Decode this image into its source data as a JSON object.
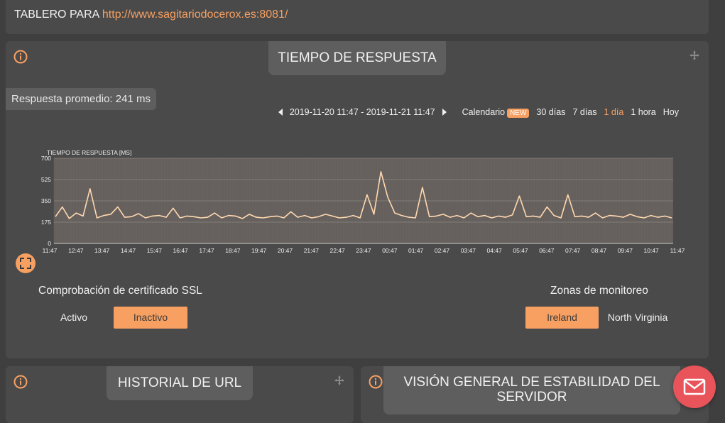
{
  "header": {
    "prefix": "TABLERO PARA",
    "url": "http://www.sagitariodocerox.es:8081/"
  },
  "response_panel": {
    "title": "TIEMPO DE RESPUESTA",
    "average": "Respuesta promedio: 241 ms",
    "date_range": "2019-11-20 11:47 - 2019-11-21 11:47",
    "calendar_label": "Calendario",
    "new_badge": "NEW",
    "ranges": [
      "30 días",
      "7 días",
      "1 día",
      "1 hora",
      "Hoy"
    ],
    "active_range": "1 día",
    "ssl": {
      "title": "Comprobación de certificado SSL",
      "active": "Activo",
      "inactive": "Inactivo",
      "selected": "Inactivo"
    },
    "zones": {
      "title": "Zonas de monitoreo",
      "options": [
        "Ireland",
        "North Virginia"
      ],
      "selected": "Ireland"
    }
  },
  "chart_data": {
    "type": "line",
    "title": "TIEMPO DE RESPUESTA [MS]",
    "xlabel": "",
    "ylabel": "TIEMPO DE RESPUESTA [MS]",
    "ylim": [
      0,
      700
    ],
    "yticks": [
      0,
      175,
      350,
      525,
      700
    ],
    "categories": [
      "11:47",
      "12:47",
      "13:47",
      "14:47",
      "15:47",
      "16:47",
      "17:47",
      "18:47",
      "19:47",
      "20:47",
      "21:47",
      "22:47",
      "23:47",
      "00:47",
      "01:47",
      "02:47",
      "03:47",
      "04:47",
      "05:47",
      "06:47",
      "07:47",
      "08:47",
      "09:47",
      "10:47",
      "11:47"
    ],
    "series": [
      {
        "values": [
          220,
          300,
          205,
          250,
          225,
          450,
          210,
          230,
          240,
          300,
          215,
          220,
          245,
          210,
          225,
          230,
          215,
          290,
          210,
          225,
          220,
          210,
          215,
          250,
          210,
          230,
          225,
          205,
          240,
          215,
          210,
          220,
          225,
          210,
          260,
          215,
          230,
          210,
          220,
          240,
          225,
          210,
          215,
          230,
          210,
          400,
          240,
          590,
          380,
          250,
          230,
          215,
          210,
          460,
          220,
          225,
          240,
          215,
          230,
          210,
          250,
          220,
          230,
          210,
          225,
          215,
          235,
          390,
          220,
          225,
          215,
          300,
          230,
          210,
          400,
          220,
          225,
          215,
          250,
          210,
          230,
          225,
          215,
          240,
          220,
          210,
          230,
          215,
          225,
          210
        ]
      }
    ],
    "line_color": "#ffd8b0",
    "plot_background": "#6a6460"
  },
  "history_panel": {
    "title": "HISTORIAL DE URL"
  },
  "stability_panel": {
    "title": "VISIÓN GENERAL DE ESTABILIDAD DEL SERVIDOR"
  },
  "colors": {
    "accent": "#f7a062",
    "panel": "#4a4a4a",
    "background": "#3f3f3f",
    "mail": "#e8545a"
  },
  "icons": {
    "info": "info-icon",
    "move": "move-icon",
    "fullscreen": "fullscreen-icon",
    "mail": "mail-icon"
  }
}
